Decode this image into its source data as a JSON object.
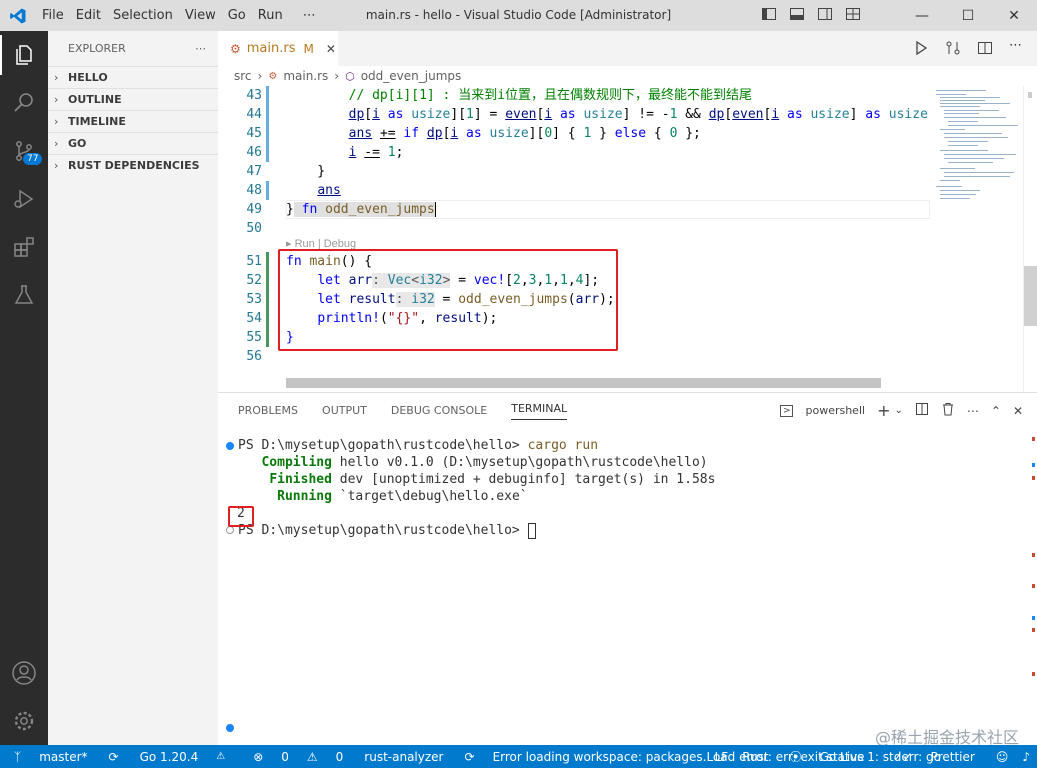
{
  "titlebar": {
    "title": "main.rs - hello - Visual Studio Code [Administrator]",
    "menu": [
      "File",
      "Edit",
      "Selection",
      "View",
      "Go",
      "Run",
      "⋯"
    ]
  },
  "activity": {
    "scm_badge": "77"
  },
  "sidebar": {
    "title": "EXPLORER",
    "sections": [
      "HELLO",
      "OUTLINE",
      "TIMELINE",
      "GO",
      "RUST DEPENDENCIES"
    ]
  },
  "tab": {
    "label": "main.rs",
    "modified": "M"
  },
  "breadcrumb": [
    "src",
    "main.rs",
    "odd_even_jumps"
  ],
  "code": {
    "line_numbers": [
      "43",
      "44",
      "45",
      "46",
      "47",
      "48",
      "49",
      "50",
      "51",
      "52",
      "53",
      "54",
      "55",
      "56"
    ],
    "comment43": "// dp[i][1] : 当来到i位置，且在偶数规则下，最终能不能到结尾",
    "codelens": "Run | Debug"
  },
  "panel": {
    "tabs": [
      "PROBLEMS",
      "OUTPUT",
      "DEBUG CONSOLE",
      "TERMINAL"
    ],
    "shell": "powershell"
  },
  "terminal": {
    "prompt1": "PS D:\\mysetup\\gopath\\rustcode\\hello> ",
    "cmd1": "cargo run",
    "compiling_label": "Compiling",
    "compiling_text": " hello v0.1.0 (D:\\mysetup\\gopath\\rustcode\\hello)",
    "finished_label": "Finished",
    "finished_text": " dev [unoptimized + debuginfo] target(s) in 1.58s",
    "running_label": "Running",
    "running_text": " `target\\debug\\hello.exe`",
    "output": "2",
    "prompt2": "PS D:\\mysetup\\gopath\\rustcode\\hello> "
  },
  "status": {
    "branch": "master*",
    "go_version": "Go 1.20.4",
    "errors": "0",
    "warnings": "0",
    "analyzer": "rust-analyzer",
    "error_msg": "Error loading workspace: packages.Load error: err: exit status 1: stderr: go",
    "eol": "LF",
    "language": "Rust",
    "golive": "Go Live",
    "prettier": "Prettier"
  },
  "watermark": "@稀土掘金技术社区",
  "colors": {
    "accent": "#007acc",
    "highlight_box": "#e02020"
  }
}
